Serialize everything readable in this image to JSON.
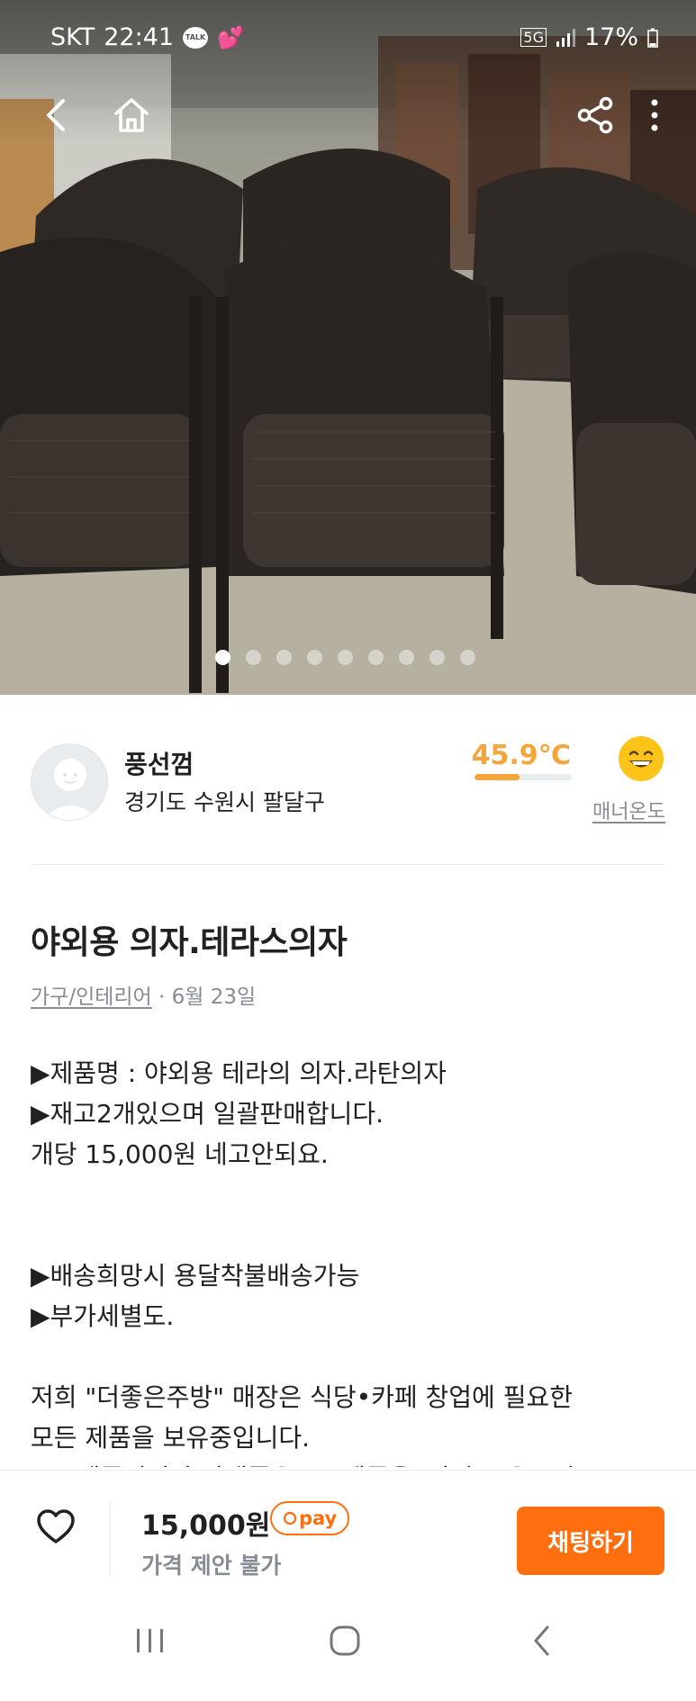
{
  "status_bar": {
    "carrier": "SKT",
    "time": "22:41",
    "talk_badge": "TALK",
    "network": "5G",
    "battery": "17%"
  },
  "photo": {
    "pager_count": 9,
    "pager_active": 0
  },
  "seller": {
    "name": "풍선껌",
    "location": "경기도 수원시 팔달구",
    "temperature": "45.9℃",
    "temperature_value": 45.9,
    "manner_label": "매너온도"
  },
  "post": {
    "title": "야외용 의자.테라스의자",
    "category": "가구/인테리어",
    "date": " · 6월 23일",
    "body_lines": [
      "▶제품명 : 야외용 테라의 의자.라탄의자",
      "▶재고2개있으며 일괄판매합니다.",
      "개당 15,000원 네고안되요.",
      "",
      "",
      "▶배송희망시 용달착불배송가능",
      "▶부가세별도.",
      "",
      "저희 \"더좋은주방\" 매장은 식당•카페 창업에 필요한",
      "모든 제품을 보유중입니다.",
      "중고제품이지만 상태좋은A급 제품을  다량 보유중이"
    ]
  },
  "footer": {
    "price": "15,000원",
    "pay_badge": "pay",
    "price_note": "가격 제안 불가",
    "chat_label": "채팅하기"
  },
  "colors": {
    "brand_orange": "#ff6f0f",
    "temperature_orange": "#f6a53b",
    "muted_gray": "#868b94"
  },
  "icons": [
    "back-icon",
    "home-icon",
    "share-icon",
    "more-vertical-icon",
    "heart-outline-icon",
    "recent-apps-icon",
    "home-circle-icon",
    "back-chevron-icon"
  ]
}
